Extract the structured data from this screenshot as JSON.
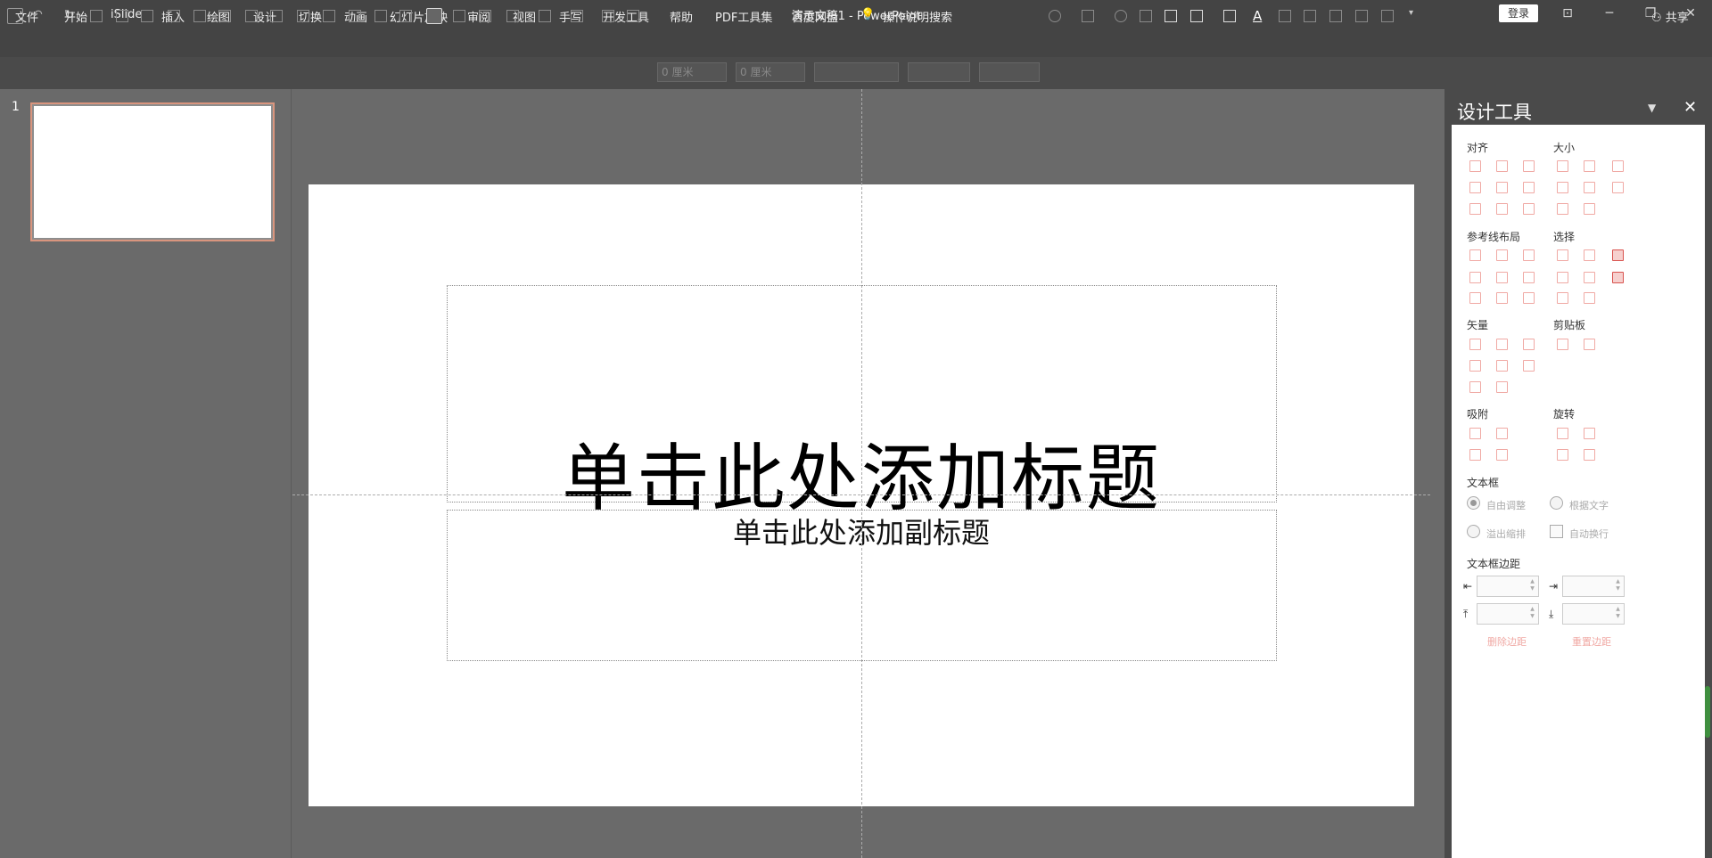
{
  "window": {
    "title": "演示文稿1  -  PowerPoint",
    "login": "登录",
    "controls": {
      "ribbon": "⊡",
      "minimize": "─",
      "restore": "❐",
      "close": "✕"
    }
  },
  "menu": [
    "文件",
    "开始",
    "iSlide",
    "插入",
    "绘图",
    "设计",
    "切换",
    "动画",
    "幻灯片放映",
    "审阅",
    "视图",
    "手写",
    "开发工具",
    "帮助",
    "PDF工具集",
    "百度网盘"
  ],
  "search": {
    "icon": "lightbulb-icon",
    "text": "操作说明搜索"
  },
  "share": "共享",
  "toolbar": {
    "width_value": "0 厘米",
    "height_value": "0 厘米",
    "fields": [
      "",
      "",
      ""
    ]
  },
  "thumbnails": {
    "slide_number": "1"
  },
  "slide": {
    "title": "单击此处添加标题",
    "subtitle": "单击此处添加副标题"
  },
  "design_pane": {
    "title": "设计工具",
    "sections": {
      "align": "对齐",
      "size": "大小",
      "guide_layout": "参考线布局",
      "select": "选择",
      "vector": "矢量",
      "clipboard": "剪贴板",
      "snap": "吸附",
      "rotate": "旋转",
      "textbox": "文本框",
      "textbox_margin": "文本框边距"
    },
    "textbox_options": {
      "auto_adjust": "自由调整",
      "fit_text": "根据文字",
      "overflow": "溢出缩排",
      "auto_wrap": "自动换行"
    },
    "buttons": {
      "delete_margin": "删除边距",
      "reset_margin": "重置边距"
    }
  }
}
